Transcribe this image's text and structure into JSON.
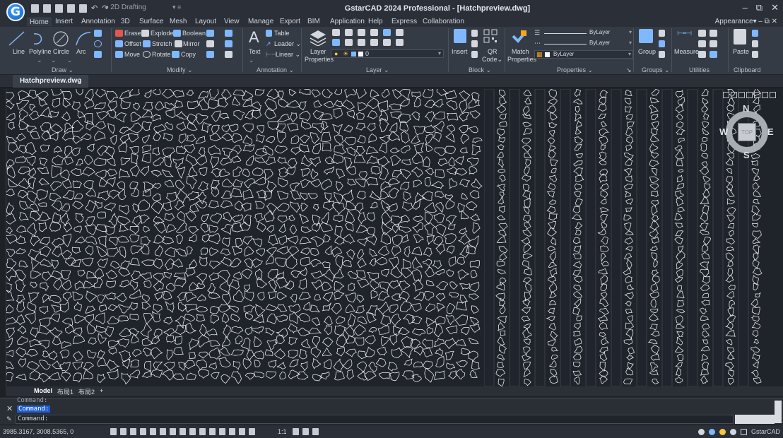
{
  "app": {
    "logo_letter": "G",
    "title": "GstarCAD 2024 Professional - [Hatchpreview.dwg]",
    "workspace": "2D Drafting",
    "window_controls": [
      "–",
      "⧉",
      "✕"
    ]
  },
  "ribbon_tabs": [
    "Home",
    "Insert",
    "Annotation",
    "3D",
    "Surface",
    "Mesh",
    "Layout",
    "View",
    "Manage",
    "Export",
    "BIM",
    "Application",
    "Help",
    "Express",
    "Collaboration"
  ],
  "appearance_label": "Appearance",
  "draw": {
    "line": "Line",
    "polyline": "Polyline",
    "circle": "Circle",
    "arc": "Arc",
    "panel": "Draw"
  },
  "modify": {
    "erase": "Erase",
    "explode": "Explode",
    "boolean": "Boolean",
    "offset": "Offset",
    "stretch": "Stretch",
    "mirror": "Mirror",
    "move": "Move",
    "rotate": "Rotate",
    "copy": "Copy",
    "panel": "Modify"
  },
  "annotation": {
    "text": "Text",
    "table": "Table",
    "leader": "Leader",
    "linear": "Linear",
    "panel": "Annotation"
  },
  "layer": {
    "properties_line1": "Layer",
    "properties_line2": "Properties",
    "current": "0",
    "panel": "Layer"
  },
  "block": {
    "insert": "Insert",
    "qr_line1": "QR",
    "qr_line2": "Code",
    "panel": "Block"
  },
  "properties": {
    "match_line1": "Match",
    "match_line2": "Properties",
    "color": "ByLayer",
    "linetype": "ByLayer",
    "lineweight": "ByLayer",
    "panel": "Properties"
  },
  "groups": {
    "group": "Group",
    "panel": "Groups"
  },
  "utilities": {
    "measure": "Measure",
    "panel": "Utilities"
  },
  "clipboard": {
    "paste": "Paste",
    "panel": "Clipboard"
  },
  "document_tab": "Hatchpreview.dwg",
  "viewcube": {
    "top": "TOP",
    "n": "N",
    "s": "S",
    "w": "W",
    "e": "E"
  },
  "layout_tabs": [
    "Model",
    "布局1",
    "布局2",
    "+"
  ],
  "command": {
    "history_1": "Command:",
    "history_2": "Command:",
    "prompt": "Command:"
  },
  "status": {
    "coordinates": "3985.3167, 3008.5365, 0",
    "scale": "1:1",
    "brand": "GstarCAD"
  },
  "colors": {
    "background": "#1f232a",
    "hatch_line": "#e6e9ee",
    "stripe_dark": "#20252d",
    "accent": "#1d5fd1"
  }
}
